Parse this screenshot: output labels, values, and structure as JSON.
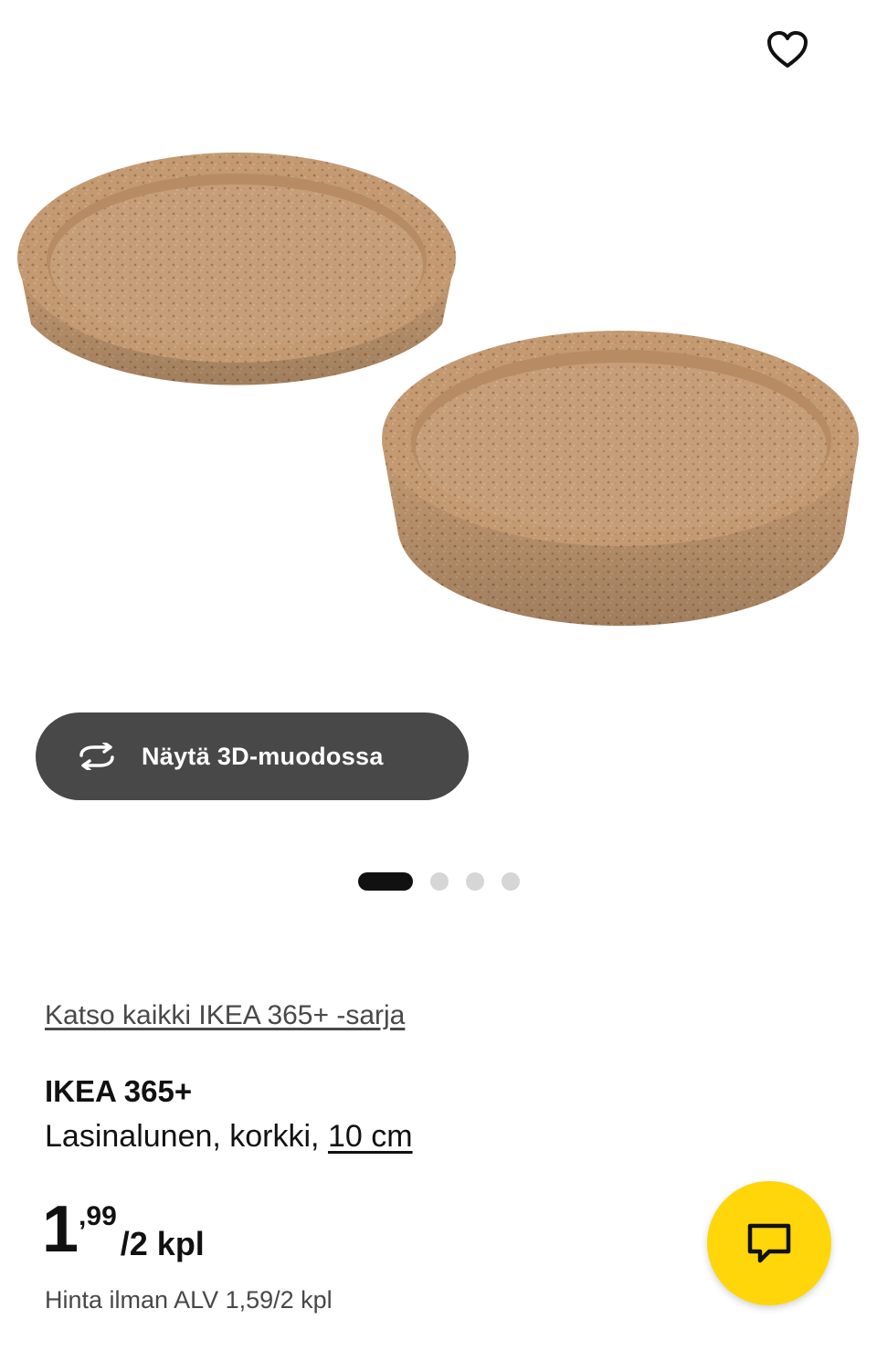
{
  "gallery": {
    "favorite_icon": "heart-icon",
    "image_alt": "IKEA 365+ Lasinalunen, korkki, 10 cm",
    "view3d_icon": "rotate-3d-icon",
    "view3d_label": "Näytä 3D-muodossa",
    "pagination": {
      "total": 4,
      "current": 1
    }
  },
  "product": {
    "series_link": "Katso kaikki IKEA 365+ -sarja",
    "name": "IKEA 365+",
    "description": "Lasinalunen, korkki,",
    "size": "10 cm",
    "price_integer": "1",
    "price_decimal": ",99",
    "price_unit": "/2 kpl",
    "price_without_vat": "Hinta ilman ALV 1,59/2 kpl"
  },
  "chat": {
    "icon": "chat-bubble-icon"
  },
  "colors": {
    "button_dark": "#484848",
    "chat_yellow": "#ffd60a",
    "cork": "#c59a72",
    "text": "#111111",
    "muted_text": "#484848"
  }
}
